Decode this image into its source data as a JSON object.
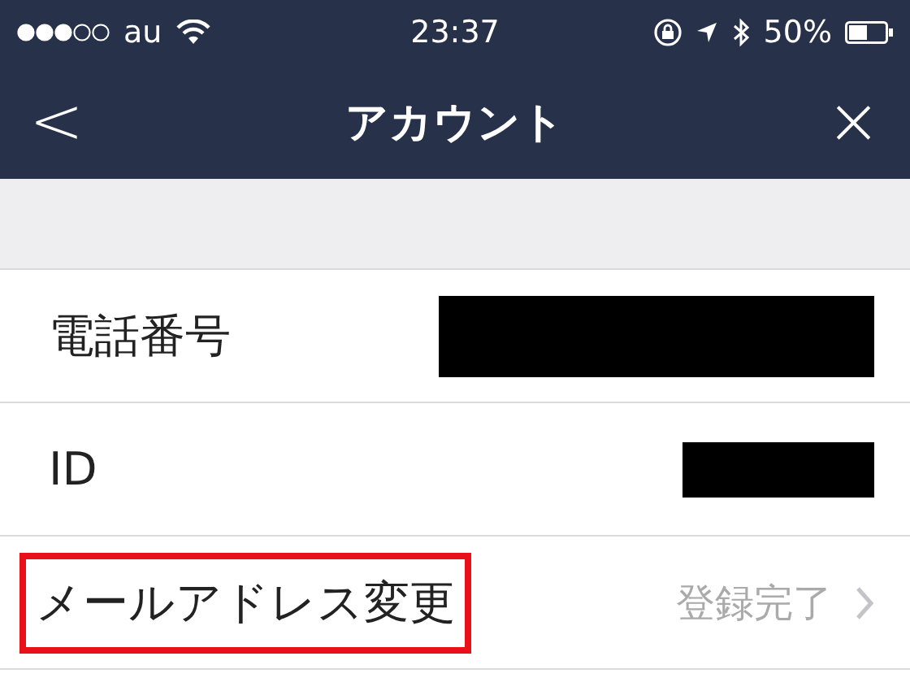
{
  "status_bar": {
    "carrier": "au",
    "time": "23:37",
    "battery_text": "50%"
  },
  "nav_bar": {
    "back": "<",
    "title": "アカウント",
    "close": "×"
  },
  "rows": [
    {
      "label": "電話番号",
      "kind": "wideredacted",
      "highlighted": false
    },
    {
      "label": "ID",
      "kind": "narrowredacted",
      "highlighted": false
    },
    {
      "label": "メールアドレス変更",
      "value": "登録完了",
      "chevron": true,
      "highlighted": true
    }
  ]
}
